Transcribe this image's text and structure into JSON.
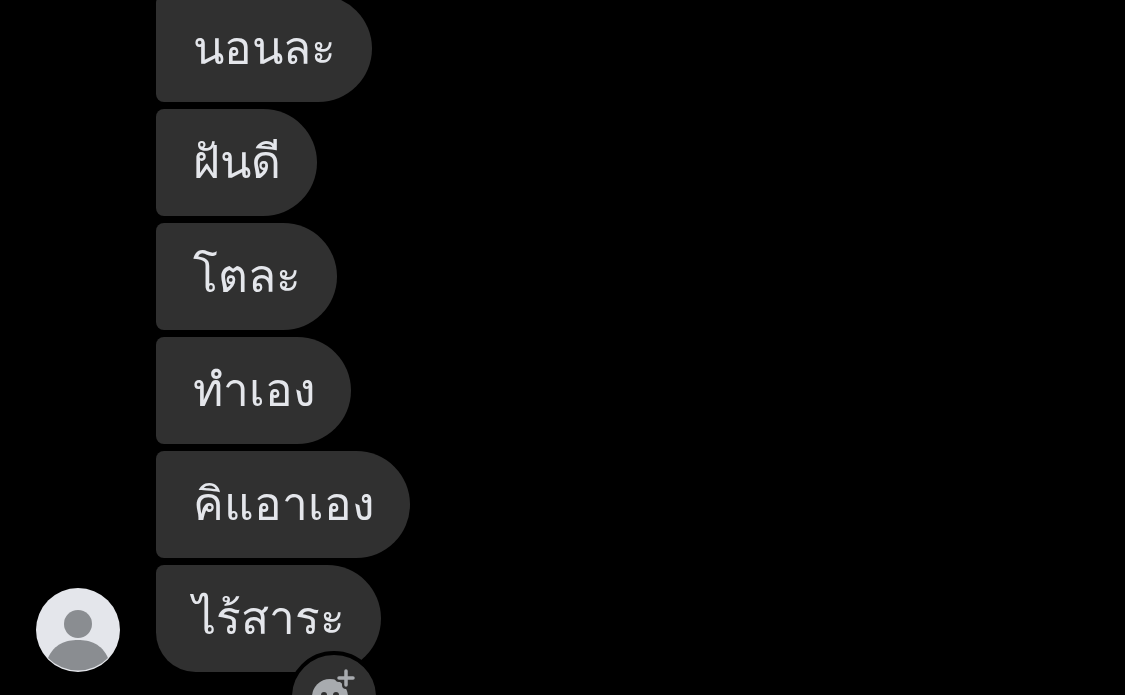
{
  "messages": [
    {
      "text": "นอนละ"
    },
    {
      "text": "ฝันดี"
    },
    {
      "text": "โตละ"
    },
    {
      "text": "ทำเอง"
    },
    {
      "text": "คิแอาเอง"
    },
    {
      "text": "ไร้สาระ"
    }
  ]
}
